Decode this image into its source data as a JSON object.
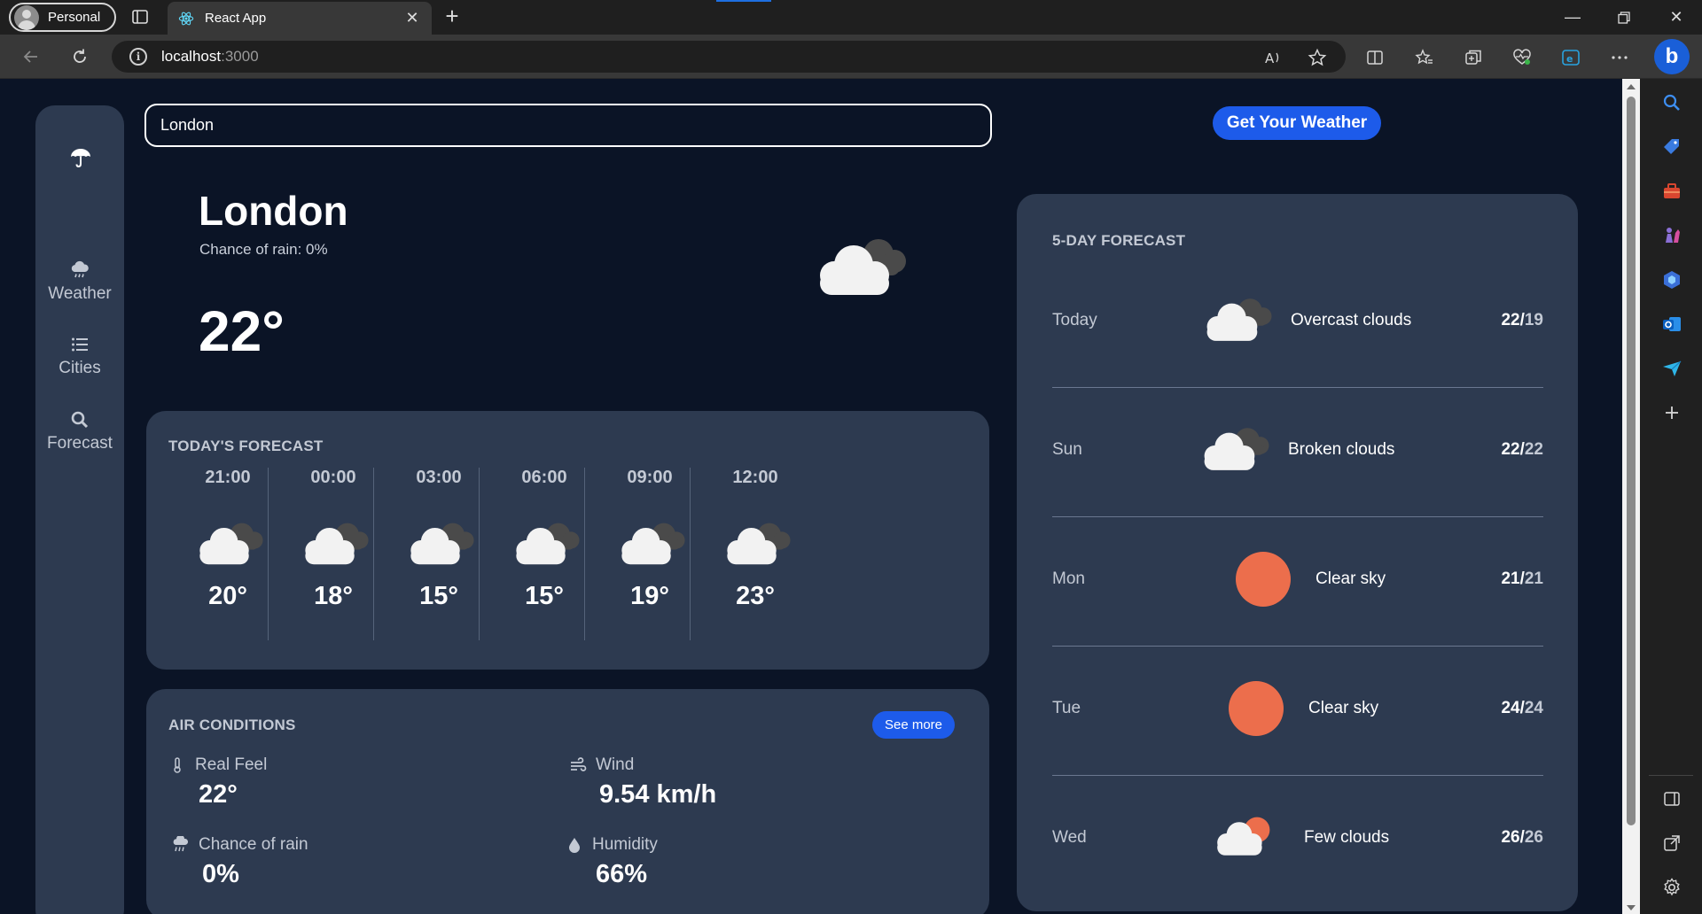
{
  "browser": {
    "profile_label": "Personal",
    "tab_title": "React App",
    "url_host": "localhost",
    "url_port": ":3000"
  },
  "app": {
    "search_value": "London",
    "get_weather_label": "Get Your Weather",
    "nav": [
      {
        "label": "Weather",
        "icon": "cloud-rain-icon"
      },
      {
        "label": "Cities",
        "icon": "list-icon"
      },
      {
        "label": "Forecast",
        "icon": "magnifier-icon"
      }
    ],
    "current": {
      "city": "London",
      "chance_of_rain": "Chance of rain: 0%",
      "temp": "22°",
      "icon": "overcast-cloud-icon"
    },
    "today": {
      "title": "TODAY'S FORECAST",
      "hours": [
        {
          "time": "21:00",
          "temp": "20°",
          "icon": "overcast-cloud-icon"
        },
        {
          "time": "00:00",
          "temp": "18°",
          "icon": "overcast-cloud-icon"
        },
        {
          "time": "03:00",
          "temp": "15°",
          "icon": "overcast-cloud-icon"
        },
        {
          "time": "06:00",
          "temp": "15°",
          "icon": "overcast-cloud-icon"
        },
        {
          "time": "09:00",
          "temp": "19°",
          "icon": "overcast-cloud-icon"
        },
        {
          "time": "12:00",
          "temp": "23°",
          "icon": "overcast-cloud-icon"
        }
      ]
    },
    "air": {
      "title": "AIR CONDITIONS",
      "see_more": "See more",
      "real_feel_label": "Real Feel",
      "real_feel_value": "22°",
      "wind_label": "Wind",
      "wind_value": "9.54 km/h",
      "rain_label": "Chance of rain",
      "rain_value": "0%",
      "humidity_label": "Humidity",
      "humidity_value": "66%"
    },
    "forecast": {
      "title": "5-DAY FORECAST",
      "days": [
        {
          "day": "Today",
          "desc": "Overcast clouds",
          "hi": "22",
          "lo": "19",
          "icon": "overcast-cloud-icon"
        },
        {
          "day": "Sun",
          "desc": "Broken clouds",
          "hi": "22",
          "lo": "22",
          "icon": "broken-cloud-icon"
        },
        {
          "day": "Mon",
          "desc": "Clear sky",
          "hi": "21",
          "lo": "21",
          "icon": "sun-icon"
        },
        {
          "day": "Tue",
          "desc": "Clear sky",
          "hi": "24",
          "lo": "24",
          "icon": "sun-icon"
        },
        {
          "day": "Wed",
          "desc": "Few clouds",
          "hi": "26",
          "lo": "26",
          "icon": "few-clouds-icon"
        }
      ]
    }
  },
  "colors": {
    "background": "#0b1426",
    "card": "#2d3a50",
    "accent": "#1d5bea",
    "sun": "#ec6e4c"
  }
}
